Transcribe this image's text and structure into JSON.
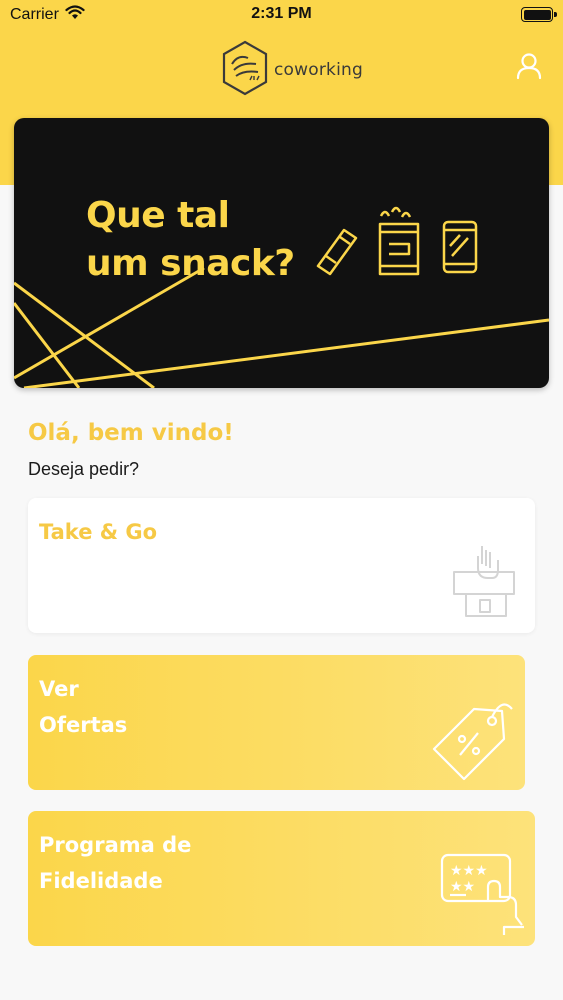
{
  "status_bar": {
    "carrier": "Carrier",
    "time": "2:31 PM",
    "wifi_icon": "wifi-icon",
    "battery_icon": "battery-icon"
  },
  "header": {
    "logo_icon": "garagem-106-logo",
    "logo_text": "coworking",
    "profile_icon": "user-icon"
  },
  "banner": {
    "line1": "Que tal",
    "line2": "um snack?",
    "icons": [
      "snack-bar-icon",
      "chips-bag-icon",
      "soda-can-icon"
    ]
  },
  "greeting": {
    "title": "Olá, bem vindo!",
    "subtitle": "Deseja pedir?"
  },
  "cards": [
    {
      "line1": "Take & Go",
      "line2": "",
      "icon": "vending-hand-icon"
    },
    {
      "line1": "Ver",
      "line2": "Ofertas",
      "icon": "discount-tag-icon"
    },
    {
      "line1": "Programa de",
      "line2": "Fidelidade",
      "icon": "loyalty-card-icon"
    }
  ],
  "colors": {
    "brand_yellow": "#fbd64a",
    "banner_black": "#111111",
    "background": "#f8f8f8"
  }
}
